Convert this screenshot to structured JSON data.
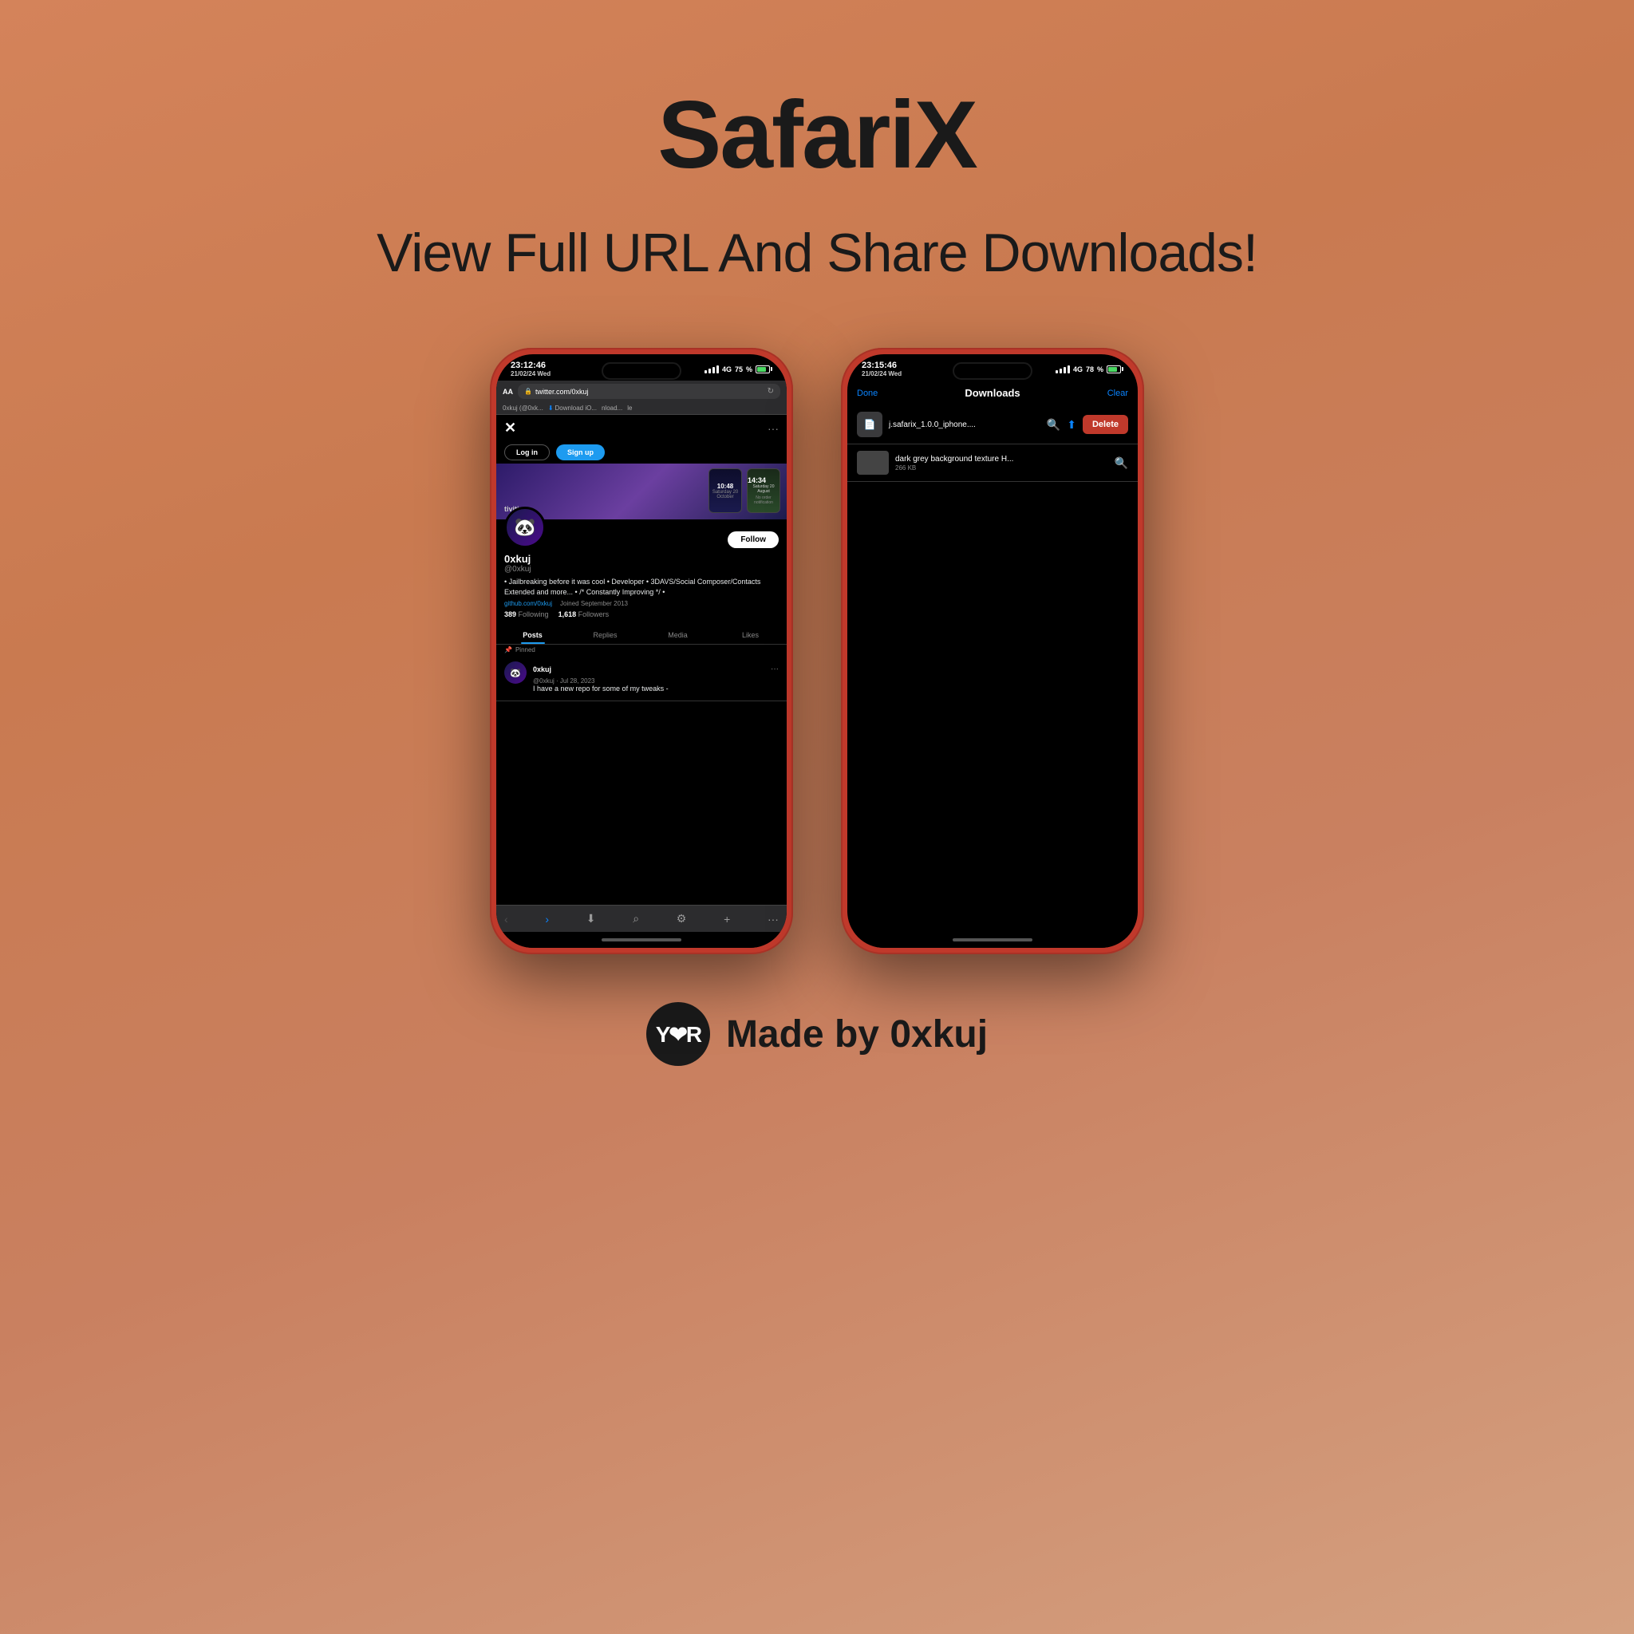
{
  "page": {
    "background": "linear-gradient(160deg, #d4835a 0%, #c97a50 30%, #c98060 60%, #d4a080 100%)"
  },
  "header": {
    "title": "SafariX",
    "subtitle": "View Full URL And Share Downloads!"
  },
  "phone1": {
    "status_bar": {
      "time": "23:12:46",
      "date": "21/02/24 Wed",
      "network": "4G",
      "battery": "75"
    },
    "safari": {
      "aa_label": "AA",
      "url": "twitter.com/0xkuj",
      "tabs": [
        "0xkuj (@0xk...",
        "Download iO...",
        "nload...",
        "le"
      ]
    },
    "twitter": {
      "login_btn": "Log in",
      "signup_btn": "Sign up",
      "x_logo": "✕",
      "profile": {
        "name": "0xkuj",
        "handle": "@0xkuj",
        "bio": "• Jailbreaking before it was cool • Developer • 3DAVS/Social Composer/Contacts Extended and more... • /* Constantly Improving */  •",
        "github": "github.com/0xkuj",
        "joined": "Joined September 2013",
        "following": "389",
        "following_label": "Following",
        "followers": "1,618",
        "followers_label": "Followers",
        "follow_btn": "Follow"
      },
      "tabs": [
        "Posts",
        "Replies",
        "Media",
        "Likes"
      ],
      "active_tab": "Posts",
      "tweet": {
        "pin_label": "Pinned",
        "author": "0xkuj",
        "handle_date": "@0xkuj · Jul 28, 2023",
        "text": "I have a new repo for some of my tweaks -"
      },
      "banner_time1": "10:48",
      "banner_time2": "14:34",
      "activities": "tivities"
    },
    "bottom_bar": {
      "back": "‹",
      "forward": "›",
      "download": "⬇",
      "search": "⌕",
      "settings": "⚙",
      "add": "+",
      "more": "···"
    }
  },
  "phone2": {
    "status_bar": {
      "time": "23:15:46",
      "date": "21/02/24 Wed",
      "network": "4G",
      "battery": "78"
    },
    "downloads": {
      "done_btn": "Done",
      "title": "Downloads",
      "clear_btn": "Clear",
      "items": [
        {
          "name": "j.safarix_1.0.0_iphone....",
          "size": "",
          "has_delete": true
        },
        {
          "name": "dark grey background texture H...",
          "size": "266 KB",
          "has_delete": false
        }
      ]
    }
  },
  "branding": {
    "logo_text": "Y❤R",
    "made_by": "Made by 0xkuj"
  }
}
